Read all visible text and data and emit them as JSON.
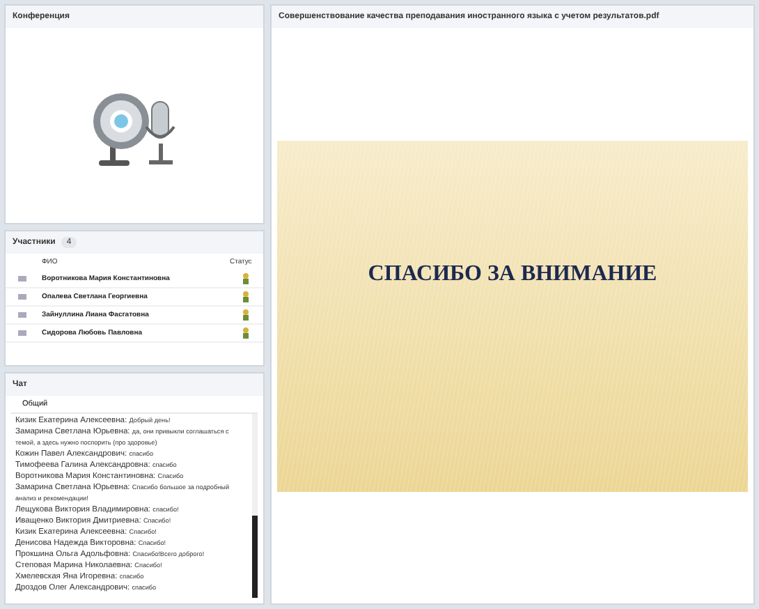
{
  "conference": {
    "title": "Конференция"
  },
  "participants": {
    "title": "Участники",
    "count": "4",
    "columns": [
      "ФИО",
      "Статус"
    ],
    "rows": [
      {
        "name": "Воротникова Мария Константиновна"
      },
      {
        "name": "Опалева Светлана Георгиевна"
      },
      {
        "name": "Зайнуллина Лиана Фасгатовна"
      },
      {
        "name": "Сидорова Любовь Павловна"
      }
    ]
  },
  "chat": {
    "title": "Чат",
    "tabs": [
      {
        "label": "Общий",
        "selected": true
      }
    ],
    "messages": [
      {
        "author": "Кизик  Екатерина Алексеевна:",
        "text": "Добрый день!"
      },
      {
        "author": "Замарина Светлана  Юрьевна:",
        "text": "да, они привыкли соглашаться с темой, а здесь нужно поспорить (про здоровье)"
      },
      {
        "author": "Кожин Павел Александрович:",
        "text": "спасибо"
      },
      {
        "author": "Тимофеева Галина Александровна:",
        "text": "спасибо"
      },
      {
        "author": "Воротникова Мария Константиновна:",
        "text": "Спасибо"
      },
      {
        "author": "Замарина Светлана  Юрьевна:",
        "text": "Спасибо большое за подробный анализ и рекомендации!"
      },
      {
        "author": "Лещукова Виктория Владимировна:",
        "text": "спасибо!"
      },
      {
        "author": "Иващенко Виктория  Дмитриевна:",
        "text": "Спасибо!"
      },
      {
        "author": "Кизик  Екатерина Алексеевна:",
        "text": "Спасибо!"
      },
      {
        "author": "Денисова Надежда Викторовна:",
        "text": "Спасибо!"
      },
      {
        "author": "Прокшина  Ольга Адольфовна:",
        "text": "Спасибо!Всего доброго!"
      },
      {
        "author": "Степовая Марина Николаевна:",
        "text": "Спасибо!"
      },
      {
        "author": "Хмелевская Яна Игоревна:",
        "text": "спасибо"
      },
      {
        "author": "Дроздов Олег Александрович:",
        "text": "спасибо"
      }
    ]
  },
  "document": {
    "title": "Совершенствование качества преподавания иностранного языка с учетом результатов.pdf",
    "slide_title": "СПАСИБО ЗА ВНИМАНИЕ"
  }
}
